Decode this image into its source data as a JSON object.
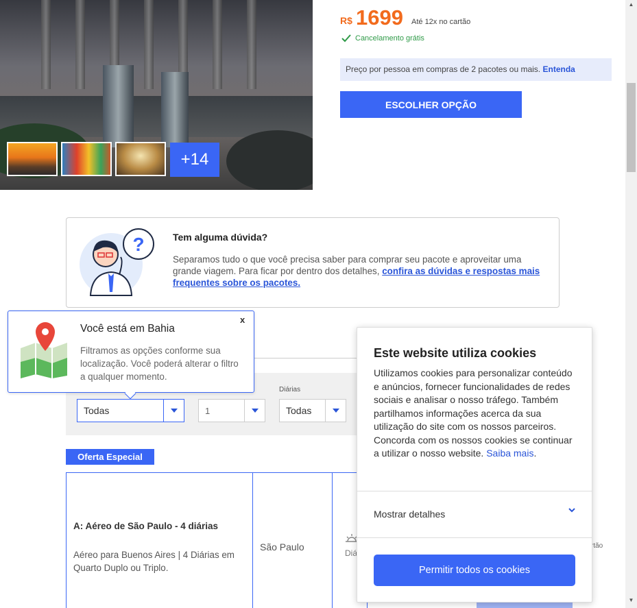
{
  "hero": {
    "more_photos": "+14"
  },
  "pricing": {
    "currency": "R$",
    "value": "1699",
    "installments": "Até 12x no cartão",
    "cancellation": "Cancelamento grátis",
    "info_text": "Preço por pessoa em compras de 2 pacotes ou mais.",
    "info_link": "Entenda",
    "choose_button": "ESCOLHER OPÇÃO"
  },
  "help": {
    "title": "Tem alguma dúvida?",
    "text": "Separamos tudo o que você precisa saber para comprar seu pacote e aproveitar uma grande viagem. Para ficar por dentro dos detalhes,",
    "link": "confira as dúvidas e respostas mais frequentes sobre os pacotes."
  },
  "location_popup": {
    "title": "Você está em Bahia",
    "text": "Filtramos as opções conforme sua localização. Você poderá alterar o filtro a qualquer momento.",
    "close": "x"
  },
  "filters": {
    "diarias_label": "Diárias",
    "origin_value": "Todas",
    "quantity_value": "1",
    "diarias_value": "Todas"
  },
  "offer": {
    "badge": "Oferta Especial",
    "title": "A: Aéreo de São Paulo - 4 diárias",
    "description": "Aéreo para Buenos Aires | 4 Diárias em Quarto Duplo ou Triplo.",
    "city": "São Paulo",
    "diarias_fragment": "Diá",
    "cartao_fragment": "rtão"
  },
  "cookies": {
    "title": "Este website utiliza cookies",
    "text": "Utilizamos cookies para personalizar conteúdo e anúncios, fornecer funcionalidades de redes sociais e analisar o nosso tráfego. Também partilhamos informações acerca da sua utilização do site com os nossos parceiros. Concorda com os nossos cookies se continuar a utilizar o nosso website.",
    "link": "Saiba mais",
    "details": "Mostrar detalhes",
    "allow_button": "Permitir todos os cookies"
  },
  "colors": {
    "accent": "#3a66f5",
    "price": "#f26b1d",
    "success": "#2e9a47"
  }
}
